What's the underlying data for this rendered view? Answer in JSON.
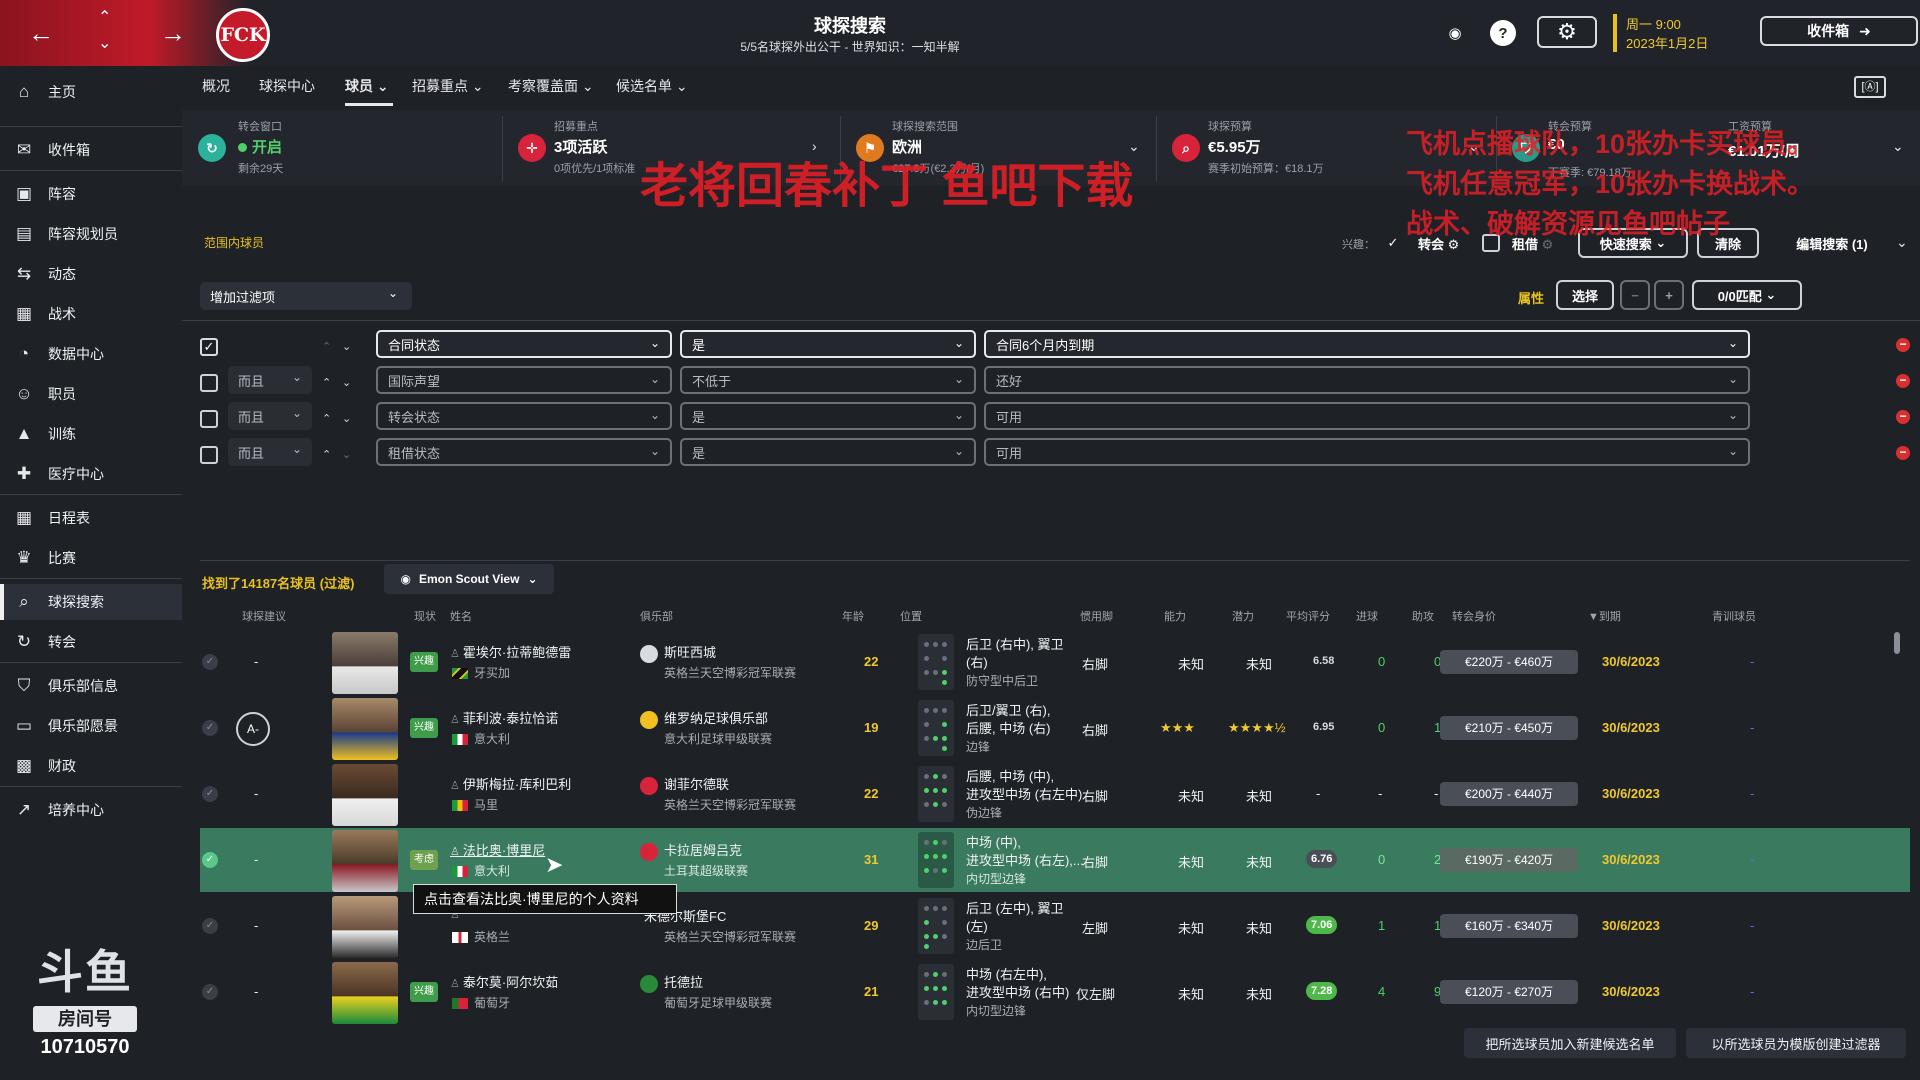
{
  "header": {
    "title": "球探搜索",
    "subtitle": "5/5名球探外出公干 - 世界知识：一知半解",
    "date_line1": "周一 9:00",
    "date_line2": "2023年1月2日",
    "inbox_label": "收件箱",
    "crest_text": "FCK"
  },
  "sidebar": {
    "items": [
      {
        "label": "主页",
        "icon": "home-icon"
      },
      {
        "label": "收件箱",
        "icon": "inbox-icon"
      },
      {
        "label": "阵容",
        "icon": "shirt-icon"
      },
      {
        "label": "阵容规划员",
        "icon": "clipboard-icon"
      },
      {
        "label": "动态",
        "icon": "dynamics-icon"
      },
      {
        "label": "战术",
        "icon": "tactics-icon"
      },
      {
        "label": "数据中心",
        "icon": "data-icon"
      },
      {
        "label": "职员",
        "icon": "staff-icon"
      },
      {
        "label": "训练",
        "icon": "training-icon"
      },
      {
        "label": "医疗中心",
        "icon": "medical-icon"
      },
      {
        "label": "日程表",
        "icon": "calendar-icon"
      },
      {
        "label": "比赛",
        "icon": "trophy-icon"
      },
      {
        "label": "球探搜索",
        "icon": "search-icon"
      },
      {
        "label": "转会",
        "icon": "transfer-icon"
      },
      {
        "label": "俱乐部信息",
        "icon": "shield-icon"
      },
      {
        "label": "俱乐部愿景",
        "icon": "vision-icon"
      },
      {
        "label": "财政",
        "icon": "finance-icon"
      },
      {
        "label": "培养中心",
        "icon": "development-icon"
      }
    ],
    "active": "球探搜索"
  },
  "douyu": {
    "logo": "斗鱼",
    "room_label": "房间号",
    "room_number": "10710570"
  },
  "tabs": [
    {
      "label": "概况"
    },
    {
      "label": "球探中心"
    },
    {
      "label": "球员"
    },
    {
      "label": "招募重点"
    },
    {
      "label": "考察覆盖面"
    },
    {
      "label": "候选名单"
    }
  ],
  "kpi": {
    "transfer_window": {
      "label": "转会窗口",
      "value": "开启",
      "sub": "剩余29天"
    },
    "focus": {
      "label": "招募重点",
      "value": "3项活跃",
      "sub": "0项优先/1项标准"
    },
    "range": {
      "label": "球探搜索范围",
      "value": "欧洲",
      "sub": "€27.8万(€2.3万/月)"
    },
    "budget": {
      "label": "球探预算",
      "value": "€5.95万",
      "sub": "赛季初始预算：€18.1万"
    },
    "transfer_budget": {
      "label": "转会预算",
      "value": "€0",
      "sub": "下赛季: €79.18万"
    },
    "wage_budget": {
      "label": "工资预算",
      "value": "€1.01万/周"
    }
  },
  "watermark": {
    "center": "老将回春补丁  鱼吧下载",
    "right1": "飞机点播球队，10张办卡买球员。",
    "right2": "飞机任意冠军，10张办卡换战术。",
    "right3": "战术、破解资源见鱼吧帖子"
  },
  "filter": {
    "range_label": "范围内球员",
    "interest_label": "兴趣：",
    "transfer_label": "转会",
    "loan_label": "租借",
    "quick_search": "快速搜索",
    "clear": "清除",
    "edit_search": "编辑搜索 (1)",
    "add_filter": "增加过滤项",
    "attr_label": "属性",
    "select": "选择",
    "match": "0/0匹配",
    "rows": [
      {
        "join": "",
        "field": "合同状态",
        "op": "是",
        "value": "合同6个月内到期",
        "checked": true
      },
      {
        "join": "而且",
        "field": "国际声望",
        "op": "不低于",
        "value": "还好",
        "checked": false
      },
      {
        "join": "而且",
        "field": "转会状态",
        "op": "是",
        "value": "可用",
        "checked": false
      },
      {
        "join": "而且",
        "field": "租借状态",
        "op": "是",
        "value": "可用",
        "checked": false
      }
    ]
  },
  "results": {
    "found": "找到了14187名球员 (过滤)",
    "view": "Emon Scout View",
    "headers": [
      "球探建议",
      "现状",
      "姓名",
      "俱乐部",
      "年龄",
      "位置",
      "惯用脚",
      "能力",
      "潜力",
      "平均评分",
      "进球",
      "助攻",
      "转会身价",
      "▼到期",
      "青训球员"
    ],
    "rows": [
      {
        "rec": "-",
        "status": "兴趣",
        "name": "霍埃尔·拉蒂鲍德雷",
        "nation": "牙买加",
        "club": "斯旺西城",
        "league": "英格兰天空博彩冠军联赛",
        "age": "22",
        "pos1": "后卫 (右中), 翼卫",
        "pos2": "(右)",
        "role": "防守型中后卫",
        "foot": "右脚",
        "ability": "未知",
        "potential": "未知",
        "avg": "6.58",
        "goals": "0",
        "assists": "0",
        "value": "€220万 - €460万",
        "expiry": "30/6/2023",
        "youth": "-"
      },
      {
        "rec": "A-",
        "status": "兴趣",
        "name": "菲利波·泰拉恰诺",
        "nation": "意大利",
        "club": "维罗纳足球俱乐部",
        "league": "意大利足球甲级联赛",
        "age": "19",
        "pos1": "后卫/翼卫 (右),",
        "pos2": "后腰, 中场 (右)",
        "role": "边锋",
        "foot": "右脚",
        "ability": "★★★",
        "potential": "★★★★½",
        "avg": "6.95",
        "goals": "0",
        "assists": "1",
        "value": "€210万 - €450万",
        "expiry": "30/6/2023",
        "youth": "-"
      },
      {
        "rec": "-",
        "status": "",
        "name": "伊斯梅拉·库利巴利",
        "nation": "马里",
        "club": "谢菲尔德联",
        "league": "英格兰天空博彩冠军联赛",
        "age": "22",
        "pos1": "后腰, 中场 (中),",
        "pos2": "进攻型中场 (右左中)",
        "role": "伪边锋",
        "foot": "右脚",
        "ability": "未知",
        "potential": "未知",
        "avg": "-",
        "goals": "-",
        "assists": "-",
        "value": "€200万 - €440万",
        "expiry": "30/6/2023",
        "youth": "-"
      },
      {
        "rec": "-",
        "status": "考虑",
        "name": "法比奥·博里尼",
        "nation": "意大利",
        "club": "卡拉居姆吕克",
        "league": "土耳其超级联赛",
        "age": "31",
        "pos1": "中场 (中),",
        "pos2": "进攻型中场 (右左),...",
        "role": "内切型边锋",
        "foot": "右脚",
        "ability": "未知",
        "potential": "未知",
        "avg": "6.76",
        "goals": "0",
        "assists": "2",
        "value": "€190万 - €420万",
        "expiry": "30/6/2023",
        "youth": "-"
      },
      {
        "rec": "-",
        "status": "",
        "name": "",
        "nation": "英格兰",
        "club": "米德尔斯堡FC",
        "league": "英格兰天空博彩冠军联赛",
        "age": "29",
        "pos1": "后卫 (左中), 翼卫",
        "pos2": "(左)",
        "role": "边后卫",
        "foot": "左脚",
        "ability": "未知",
        "potential": "未知",
        "avg": "7.06",
        "goals": "1",
        "assists": "1",
        "value": "€160万 - €340万",
        "expiry": "30/6/2023",
        "youth": "-"
      },
      {
        "rec": "-",
        "status": "兴趣",
        "name": "泰尔莫·阿尔坎茹",
        "nation": "葡萄牙",
        "club": "托德拉",
        "league": "葡萄牙足球甲级联赛",
        "age": "21",
        "pos1": "中场 (右左中),",
        "pos2": "进攻型中场 (右中)",
        "role": "内切型边锋",
        "foot": "仅左脚",
        "ability": "未知",
        "potential": "未知",
        "avg": "7.28",
        "goals": "4",
        "assists": "9",
        "value": "€120万 - €270万",
        "expiry": "30/6/2023",
        "youth": "-"
      }
    ]
  },
  "tooltip": "点击查看法比奥·博里尼的个人资料",
  "bottom": {
    "add_shortlist": "把所选球员加入新建候选名单",
    "create_filter": "以所选球员为模版创建过滤器"
  }
}
